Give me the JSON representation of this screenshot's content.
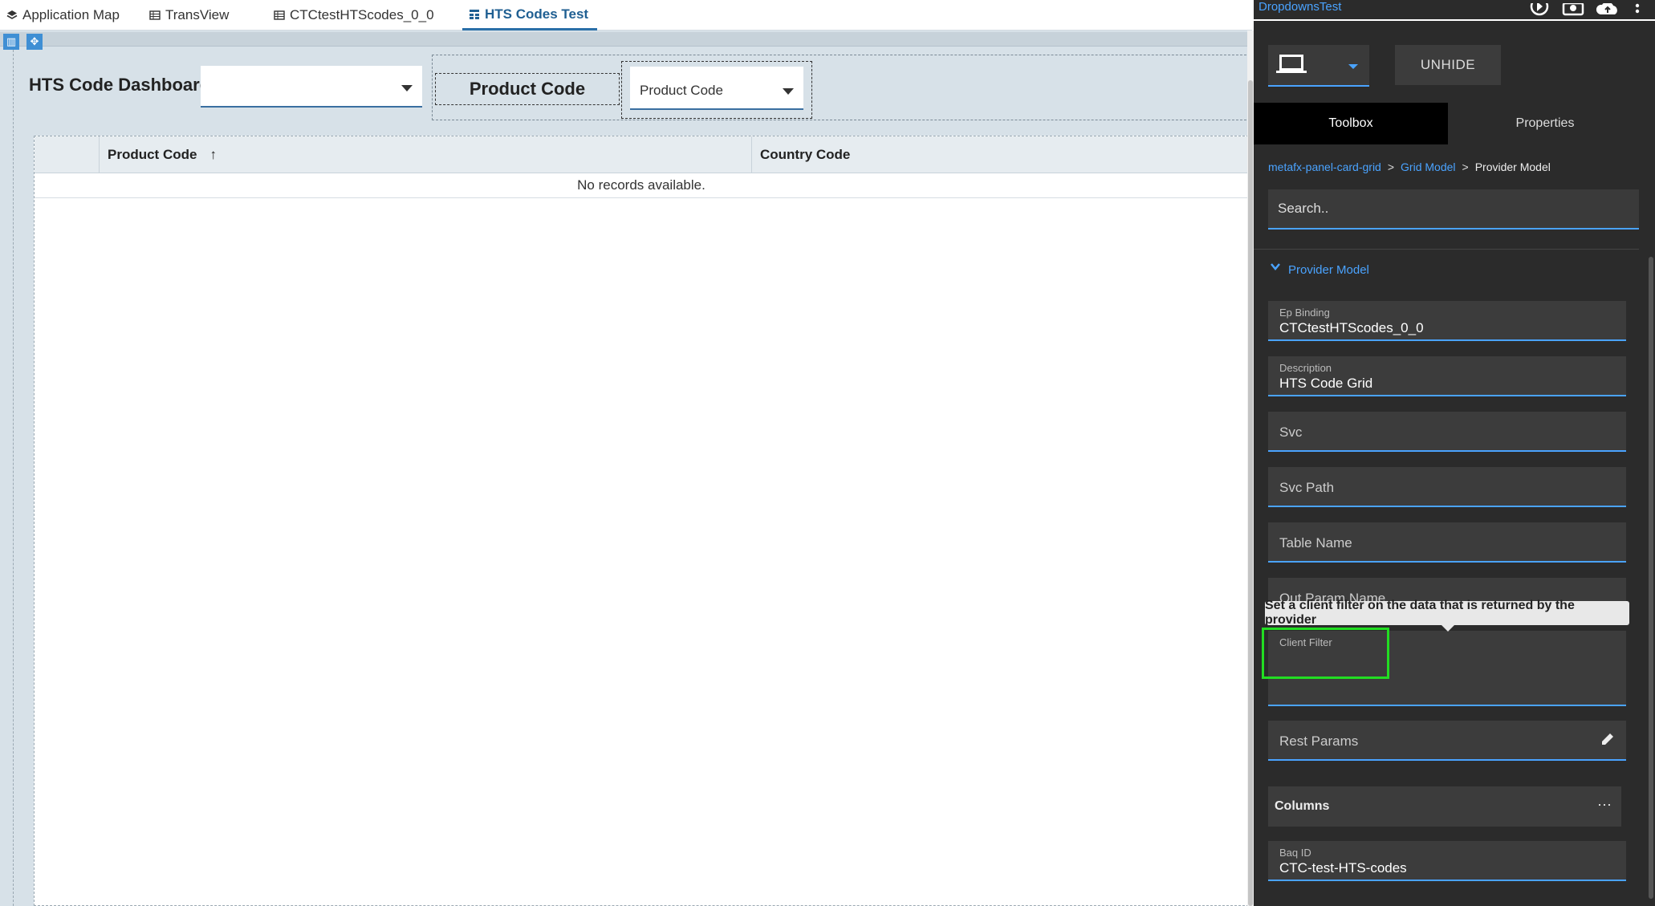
{
  "tabs": [
    {
      "label": "Application Map",
      "icon": "layers-icon"
    },
    {
      "label": "TransView",
      "icon": "table-icon"
    },
    {
      "label": "CTCtestHTScodes_0_0",
      "icon": "table-icon"
    },
    {
      "label": "HTS Codes Test",
      "icon": "grid-icon",
      "active": true
    }
  ],
  "canvas": {
    "dashboard_title": "HTS Code Dashboard",
    "dashboard_dropdown_value": "",
    "product_code_label": "Product Code",
    "product_code_dropdown": "Product Code",
    "grid": {
      "columns": [
        "",
        "Product Code",
        "Country Code"
      ],
      "sort_indicator": "↑",
      "empty_message": "No records available."
    }
  },
  "right_panel": {
    "title": "DropdownsTest",
    "device_select": "laptop",
    "unhide_label": "UNHIDE",
    "tabs": {
      "toolbox": "Toolbox",
      "properties": "Properties"
    },
    "breadcrumb": [
      "metafx-panel-card-grid",
      "Grid Model",
      "Provider Model"
    ],
    "search_placeholder": "Search..",
    "section_title": "Provider Model",
    "fields": {
      "ep_binding": {
        "label": "Ep Binding",
        "value": "CTCtestHTScodes_0_0"
      },
      "description": {
        "label": "Description",
        "value": "HTS Code Grid"
      },
      "svc": {
        "label": "Svc"
      },
      "svc_path": {
        "label": "Svc Path"
      },
      "table_name": {
        "label": "Table Name"
      },
      "out_param_name": {
        "label": "Out Param Name"
      },
      "client_filter": {
        "label": "Client Filter",
        "value": ""
      },
      "rest_params": {
        "label": "Rest Params"
      },
      "columns": {
        "label": "Columns",
        "more": "···"
      },
      "baq_id": {
        "label": "Baq ID",
        "value": "CTC-test-HTS-codes"
      }
    },
    "tooltip": "Set a client filter on the data that is returned by the provider",
    "accent_color": "#4aa3ff",
    "highlight_color": "#22dd22"
  }
}
